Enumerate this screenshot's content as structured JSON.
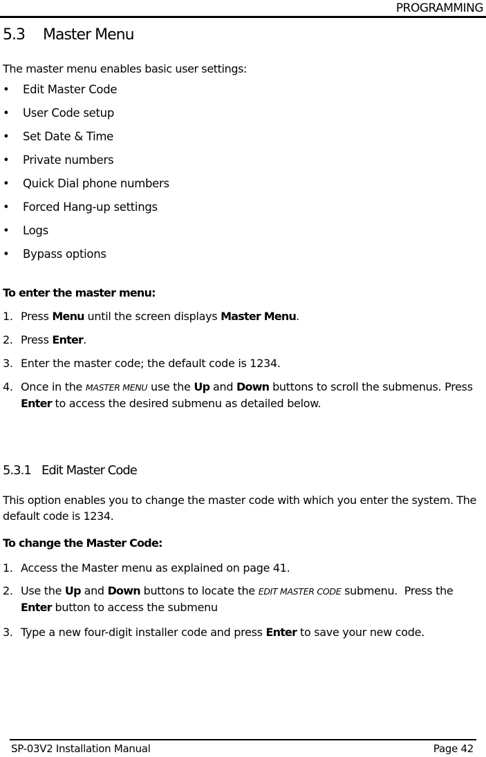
{
  "header": {
    "section_label": "PROGRAMMING"
  },
  "section": {
    "number": "5.3",
    "title": "Master Menu",
    "intro": "The master menu enables basic user settings:",
    "features": [
      "Edit Master Code",
      "User Code setup",
      "Set Date & Time",
      "Private numbers",
      "Quick Dial phone numbers",
      "Forced Hang-up settings",
      "Logs",
      "Bypass options"
    ],
    "bullet": "•",
    "enter_heading": "To enter the master menu:",
    "enter_steps": [
      {
        "n": "1.",
        "parts": [
          "Press ",
          "Menu",
          " until the screen displays ",
          "Master Menu",
          "."
        ]
      },
      {
        "n": "2.",
        "parts": [
          "Press ",
          "Enter",
          "."
        ]
      },
      {
        "n": "3.",
        "text": "Enter the master code; the default code is 1234."
      },
      {
        "n": "4.",
        "parts": [
          "Once in the ",
          "Master Menu",
          " use the ",
          "Up",
          " and ",
          "Down",
          " buttons to scroll the submenus. Press ",
          "Enter",
          " to access the desired submenu as detailed below."
        ]
      }
    ]
  },
  "subsection": {
    "number": "5.3.1",
    "title": "Edit Master Code",
    "description": "This option enables you to change the master code with which you enter the system. The default code is 1234.",
    "change_heading": "To change the Master Code:",
    "steps": [
      {
        "n": "1.",
        "text": "Access the Master menu as explained on page 41."
      },
      {
        "n": "2.",
        "parts": [
          "Use the ",
          "Up",
          " and ",
          "Down",
          " buttons to locate the ",
          "Edit Master Code",
          " submenu.  Press the ",
          "Enter",
          " button to access the submenu"
        ]
      },
      {
        "n": "3.",
        "parts": [
          "Type a new four-digit installer code and press ",
          "Enter",
          " to save your new code."
        ]
      }
    ]
  },
  "footer": {
    "manual_name": "SP-03V2 Installation Manual",
    "page_label": "Page 42"
  }
}
